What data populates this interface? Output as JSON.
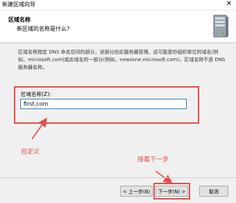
{
  "window": {
    "title": "新建区域向导",
    "close_glyph": "✕"
  },
  "header": {
    "title": "区域名称",
    "subtitle": "新区域的名称是什么?"
  },
  "description": "区域名称指定 DNS 命名空间的部分，该部分由此服务器管理。这可能是你组织单位的域名(例如，microsoft.com)或此域名的一部分(例如，newzone.microsoft.com)。区域名称不是 DNS 服务器名称。",
  "zone_name": {
    "label": "区域名称(Z):",
    "value": "first.com"
  },
  "annotations": {
    "custom": "自定义",
    "next_step": "接着下一步"
  },
  "buttons": {
    "back": "< 上一步(B)",
    "next": "下一步(N) >",
    "cancel": "取消"
  },
  "colors": {
    "annotation_red": "#e94a4a",
    "input_border": "#3c7fb1"
  }
}
